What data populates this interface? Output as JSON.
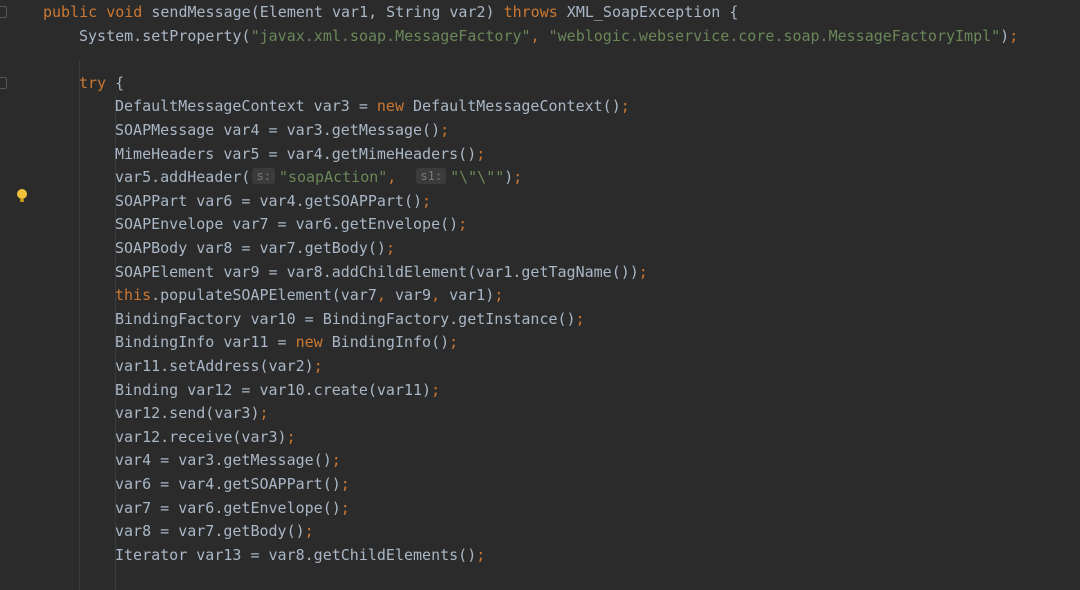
{
  "lines": [
    {
      "tokens": [
        {
          "t": "public void ",
          "c": "kw"
        },
        {
          "t": "sendMessage(Element var1, String var2) ",
          "c": ""
        },
        {
          "t": "throws ",
          "c": "kw"
        },
        {
          "t": "XML_SoapException {",
          "c": ""
        }
      ]
    },
    {
      "tokens": [
        {
          "t": "System.setProperty(",
          "c": ""
        },
        {
          "t": "\"javax.xml.soap.MessageFactory\"",
          "c": "str"
        },
        {
          "t": ", ",
          "c": "punc"
        },
        {
          "t": "\"weblogic.webservice.core.soap.MessageFactoryImpl\"",
          "c": "str"
        },
        {
          "t": ")",
          "c": ""
        },
        {
          "t": ";",
          "c": "punc"
        }
      ]
    },
    {
      "tokens": []
    },
    {
      "tokens": [
        {
          "t": "try ",
          "c": "kw"
        },
        {
          "t": "{",
          "c": ""
        }
      ]
    },
    {
      "tokens": [
        {
          "t": "DefaultMessageContext var3 = ",
          "c": ""
        },
        {
          "t": "new ",
          "c": "kw"
        },
        {
          "t": "DefaultMessageContext()",
          "c": ""
        },
        {
          "t": ";",
          "c": "punc"
        }
      ]
    },
    {
      "tokens": [
        {
          "t": "SOAPMessage var4 = var3.getMessage()",
          "c": ""
        },
        {
          "t": ";",
          "c": "punc"
        }
      ]
    },
    {
      "tokens": [
        {
          "t": "MimeHeaders var5 = var4.getMimeHeaders()",
          "c": ""
        },
        {
          "t": ";",
          "c": "punc"
        }
      ]
    },
    {
      "tokens": [
        {
          "t": "var5.addHeader(",
          "c": ""
        },
        {
          "t": "s:",
          "c": "hint"
        },
        {
          "t": "\"soapAction\"",
          "c": "str"
        },
        {
          "t": ",  ",
          "c": "punc"
        },
        {
          "t": "s1:",
          "c": "hint"
        },
        {
          "t": "\"\\\"\\\"\"",
          "c": "str"
        },
        {
          "t": ")",
          "c": ""
        },
        {
          "t": ";",
          "c": "punc"
        }
      ]
    },
    {
      "tokens": [
        {
          "t": "SOAPPart var6 = var4.getSOAPPart()",
          "c": ""
        },
        {
          "t": ";",
          "c": "punc"
        }
      ]
    },
    {
      "tokens": [
        {
          "t": "SOAPEnvelope var7 = var6.getEnvelope()",
          "c": ""
        },
        {
          "t": ";",
          "c": "punc"
        }
      ]
    },
    {
      "tokens": [
        {
          "t": "SOAPBody var8 = var7.getBody()",
          "c": ""
        },
        {
          "t": ";",
          "c": "punc"
        }
      ]
    },
    {
      "tokens": [
        {
          "t": "SOAPElement var9 = var8.addChildElement(var1.getTagName())",
          "c": ""
        },
        {
          "t": ";",
          "c": "punc"
        }
      ]
    },
    {
      "tokens": [
        {
          "t": "this",
          "c": "kw"
        },
        {
          "t": ".populateSOAPElement(var7",
          "c": ""
        },
        {
          "t": ", ",
          "c": "punc"
        },
        {
          "t": "var9",
          "c": ""
        },
        {
          "t": ", ",
          "c": "punc"
        },
        {
          "t": "var1)",
          "c": ""
        },
        {
          "t": ";",
          "c": "punc"
        }
      ]
    },
    {
      "tokens": [
        {
          "t": "BindingFactory var10 = BindingFactory.getInstance()",
          "c": ""
        },
        {
          "t": ";",
          "c": "punc"
        }
      ]
    },
    {
      "tokens": [
        {
          "t": "BindingInfo var11 = ",
          "c": ""
        },
        {
          "t": "new ",
          "c": "kw"
        },
        {
          "t": "BindingInfo()",
          "c": ""
        },
        {
          "t": ";",
          "c": "punc"
        }
      ]
    },
    {
      "tokens": [
        {
          "t": "var11.setAddress(var2)",
          "c": ""
        },
        {
          "t": ";",
          "c": "punc"
        }
      ]
    },
    {
      "tokens": [
        {
          "t": "Binding var12 = var10.create(var11)",
          "c": ""
        },
        {
          "t": ";",
          "c": "punc"
        }
      ]
    },
    {
      "tokens": [
        {
          "t": "var12.send(var3)",
          "c": ""
        },
        {
          "t": ";",
          "c": "punc"
        }
      ]
    },
    {
      "tokens": [
        {
          "t": "var12.receive(var3)",
          "c": ""
        },
        {
          "t": ";",
          "c": "punc"
        }
      ]
    },
    {
      "tokens": [
        {
          "t": "var4 = var3.getMessage()",
          "c": ""
        },
        {
          "t": ";",
          "c": "punc"
        }
      ]
    },
    {
      "tokens": [
        {
          "t": "var6 = var4.getSOAPPart()",
          "c": ""
        },
        {
          "t": ";",
          "c": "punc"
        }
      ]
    },
    {
      "tokens": [
        {
          "t": "var7 = var6.getEnvelope()",
          "c": ""
        },
        {
          "t": ";",
          "c": "punc"
        }
      ]
    },
    {
      "tokens": [
        {
          "t": "var8 = var7.getBody()",
          "c": ""
        },
        {
          "t": ";",
          "c": "punc"
        }
      ]
    },
    {
      "tokens": [
        {
          "t": "Iterator var13 = var8.getChildElements()",
          "c": ""
        },
        {
          "t": ";",
          "c": "punc"
        }
      ]
    }
  ],
  "icons": {
    "intention_bulb": "lightbulb-icon",
    "fold_markers": "fold-icon"
  },
  "colors": {
    "background": "#2b2b2b",
    "text": "#a9b7c6",
    "keyword": "#cc7832",
    "string": "#6a8759",
    "hint_bg": "#3b3b3b",
    "hint_fg": "#787878",
    "bulb": "#f0c23b"
  }
}
